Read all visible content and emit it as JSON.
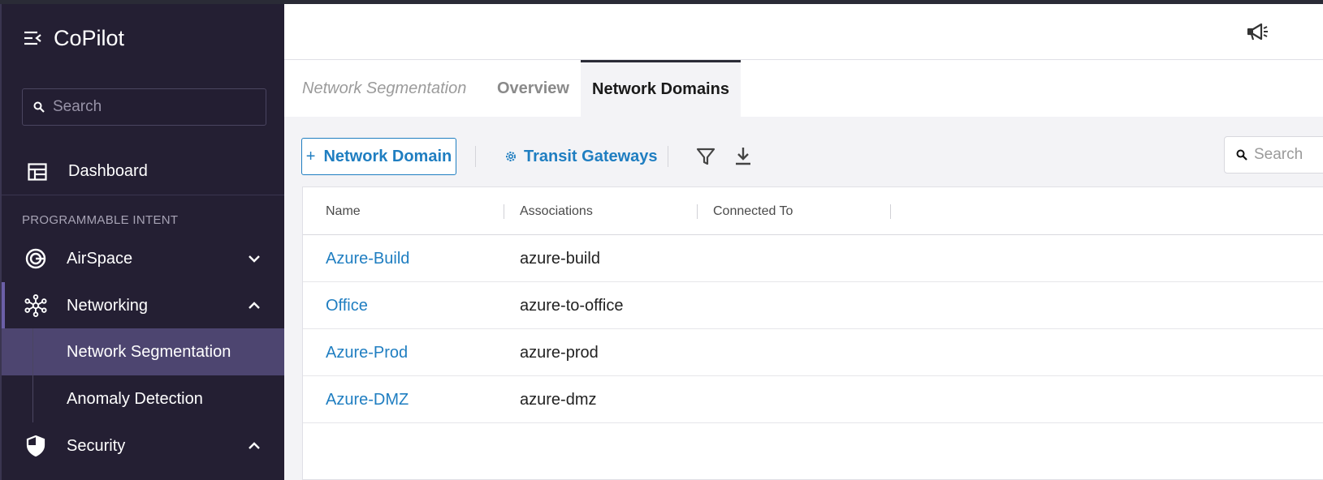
{
  "app": {
    "title": "CoPilot"
  },
  "sidebar": {
    "search_placeholder": "Search",
    "dashboard_label": "Dashboard",
    "section_label": "PROGRAMMABLE INTENT",
    "items": [
      {
        "label": "AirSpace",
        "icon": "airspace-icon",
        "expanded": false
      },
      {
        "label": "Networking",
        "icon": "network-nodes-icon",
        "expanded": true
      },
      {
        "label": "Security",
        "icon": "shield-icon",
        "expanded": true
      }
    ],
    "networking_sub": [
      {
        "label": "Network Segmentation",
        "active": true
      },
      {
        "label": "Anomaly Detection",
        "active": false
      }
    ]
  },
  "tabs": {
    "breadcrumb": "Network Segmentation",
    "overview": "Overview",
    "network_domains": "Network Domains"
  },
  "toolbar": {
    "add_label": "Network Domain",
    "transit_label": "Transit Gateways",
    "search_placeholder": "Search"
  },
  "table": {
    "columns": [
      "Name",
      "Associations",
      "Connected To"
    ],
    "rows": [
      {
        "name": "Azure-Build",
        "associations": "azure-build",
        "connected_to": ""
      },
      {
        "name": "Office",
        "associations": "azure-to-office",
        "connected_to": ""
      },
      {
        "name": "Azure-Prod",
        "associations": "azure-prod",
        "connected_to": ""
      },
      {
        "name": "Azure-DMZ",
        "associations": "azure-dmz",
        "connected_to": ""
      }
    ]
  },
  "colors": {
    "sidebar_bg": "#241f33",
    "sidebar_active": "#4d4570",
    "link": "#1f7ec1",
    "content_bg": "#f3f3f6"
  }
}
